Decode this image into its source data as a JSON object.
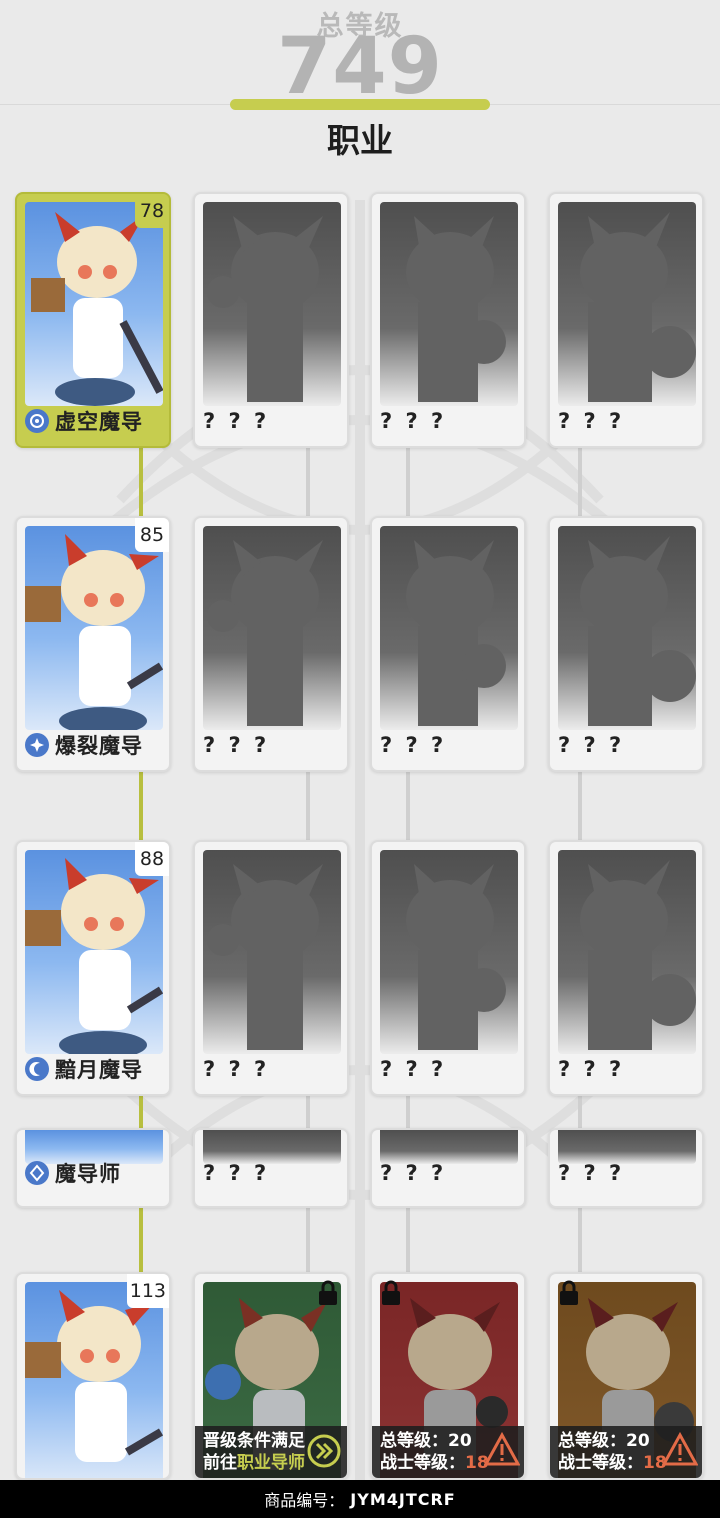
{
  "header": {
    "total_label": "总等级",
    "total_value": "749",
    "section_title": "职业"
  },
  "colors": {
    "accent": "#c6cd4f",
    "background": "#eaeaea",
    "warning": "#e36b47"
  },
  "rows": [
    {
      "cards": [
        {
          "name": "虚空魔导",
          "level": "78",
          "state": "selected"
        },
        {
          "name": "? ? ?",
          "state": "hidden"
        },
        {
          "name": "? ? ?",
          "state": "hidden"
        },
        {
          "name": "? ? ?",
          "state": "hidden"
        }
      ]
    },
    {
      "cards": [
        {
          "name": "爆裂魔导",
          "level": "85",
          "state": "unlocked"
        },
        {
          "name": "? ? ?",
          "state": "hidden"
        },
        {
          "name": "? ? ?",
          "state": "hidden"
        },
        {
          "name": "? ? ?",
          "state": "hidden"
        }
      ]
    },
    {
      "cards": [
        {
          "name": "黯月魔导",
          "level": "88",
          "state": "unlocked"
        },
        {
          "name": "? ? ?",
          "state": "hidden"
        },
        {
          "name": "? ? ?",
          "state": "hidden"
        },
        {
          "name": "? ? ?",
          "state": "hidden"
        }
      ]
    },
    {
      "cards": [
        {
          "name": "魔导师",
          "state": "unlocked"
        },
        {
          "name": "? ? ?",
          "state": "hidden"
        },
        {
          "name": "? ? ?",
          "state": "hidden"
        },
        {
          "name": "? ? ?",
          "state": "hidden"
        }
      ]
    },
    {
      "cards": [
        {
          "level": "113",
          "state": "unlocked"
        },
        {
          "state": "locked",
          "icon": "lock-icon",
          "condition_line1": "晋级条件满足",
          "condition_line2_prefix": "前往",
          "condition_line2_highlight": "职业导师"
        },
        {
          "state": "locked",
          "icon": "lock-icon",
          "condition_line1_label": "总等级：",
          "condition_line1_value": "20",
          "condition_line2_label": "战士等级：",
          "condition_line2_value": "18"
        },
        {
          "state": "locked",
          "icon": "lock-icon",
          "condition_line1_label": "总等级：",
          "condition_line1_value": "20",
          "condition_line2_label": "战士等级：",
          "condition_line2_value": "18"
        }
      ]
    }
  ],
  "footer": {
    "label": "商品编号：",
    "code": "JYM4JTCRF"
  }
}
